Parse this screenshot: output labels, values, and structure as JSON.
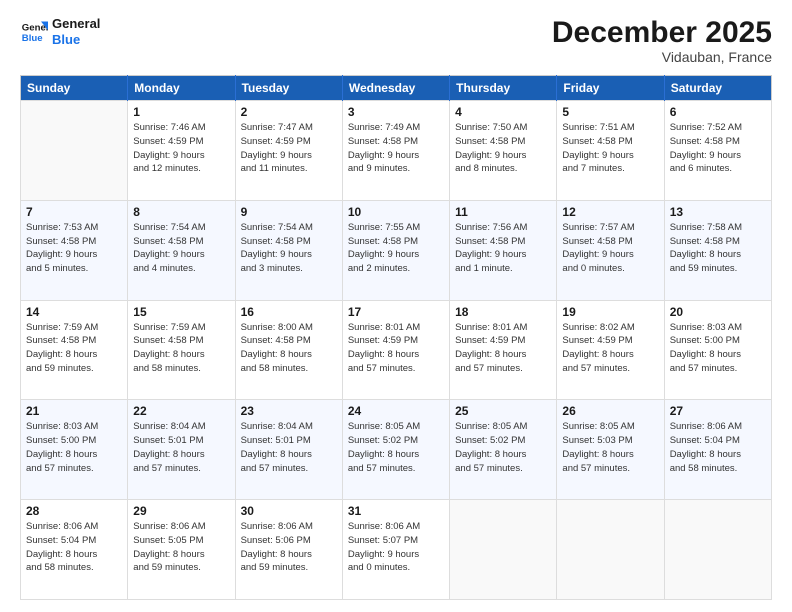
{
  "header": {
    "logo_line1": "General",
    "logo_line2": "Blue",
    "main_title": "December 2025",
    "subtitle": "Vidauban, France"
  },
  "calendar": {
    "weekdays": [
      "Sunday",
      "Monday",
      "Tuesday",
      "Wednesday",
      "Thursday",
      "Friday",
      "Saturday"
    ],
    "rows": [
      [
        {
          "day": "",
          "detail": ""
        },
        {
          "day": "1",
          "detail": "Sunrise: 7:46 AM\nSunset: 4:59 PM\nDaylight: 9 hours\nand 12 minutes."
        },
        {
          "day": "2",
          "detail": "Sunrise: 7:47 AM\nSunset: 4:59 PM\nDaylight: 9 hours\nand 11 minutes."
        },
        {
          "day": "3",
          "detail": "Sunrise: 7:49 AM\nSunset: 4:58 PM\nDaylight: 9 hours\nand 9 minutes."
        },
        {
          "day": "4",
          "detail": "Sunrise: 7:50 AM\nSunset: 4:58 PM\nDaylight: 9 hours\nand 8 minutes."
        },
        {
          "day": "5",
          "detail": "Sunrise: 7:51 AM\nSunset: 4:58 PM\nDaylight: 9 hours\nand 7 minutes."
        },
        {
          "day": "6",
          "detail": "Sunrise: 7:52 AM\nSunset: 4:58 PM\nDaylight: 9 hours\nand 6 minutes."
        }
      ],
      [
        {
          "day": "7",
          "detail": "Sunrise: 7:53 AM\nSunset: 4:58 PM\nDaylight: 9 hours\nand 5 minutes."
        },
        {
          "day": "8",
          "detail": "Sunrise: 7:54 AM\nSunset: 4:58 PM\nDaylight: 9 hours\nand 4 minutes."
        },
        {
          "day": "9",
          "detail": "Sunrise: 7:54 AM\nSunset: 4:58 PM\nDaylight: 9 hours\nand 3 minutes."
        },
        {
          "day": "10",
          "detail": "Sunrise: 7:55 AM\nSunset: 4:58 PM\nDaylight: 9 hours\nand 2 minutes."
        },
        {
          "day": "11",
          "detail": "Sunrise: 7:56 AM\nSunset: 4:58 PM\nDaylight: 9 hours\nand 1 minute."
        },
        {
          "day": "12",
          "detail": "Sunrise: 7:57 AM\nSunset: 4:58 PM\nDaylight: 9 hours\nand 0 minutes."
        },
        {
          "day": "13",
          "detail": "Sunrise: 7:58 AM\nSunset: 4:58 PM\nDaylight: 8 hours\nand 59 minutes."
        }
      ],
      [
        {
          "day": "14",
          "detail": "Sunrise: 7:59 AM\nSunset: 4:58 PM\nDaylight: 8 hours\nand 59 minutes."
        },
        {
          "day": "15",
          "detail": "Sunrise: 7:59 AM\nSunset: 4:58 PM\nDaylight: 8 hours\nand 58 minutes."
        },
        {
          "day": "16",
          "detail": "Sunrise: 8:00 AM\nSunset: 4:58 PM\nDaylight: 8 hours\nand 58 minutes."
        },
        {
          "day": "17",
          "detail": "Sunrise: 8:01 AM\nSunset: 4:59 PM\nDaylight: 8 hours\nand 57 minutes."
        },
        {
          "day": "18",
          "detail": "Sunrise: 8:01 AM\nSunset: 4:59 PM\nDaylight: 8 hours\nand 57 minutes."
        },
        {
          "day": "19",
          "detail": "Sunrise: 8:02 AM\nSunset: 4:59 PM\nDaylight: 8 hours\nand 57 minutes."
        },
        {
          "day": "20",
          "detail": "Sunrise: 8:03 AM\nSunset: 5:00 PM\nDaylight: 8 hours\nand 57 minutes."
        }
      ],
      [
        {
          "day": "21",
          "detail": "Sunrise: 8:03 AM\nSunset: 5:00 PM\nDaylight: 8 hours\nand 57 minutes."
        },
        {
          "day": "22",
          "detail": "Sunrise: 8:04 AM\nSunset: 5:01 PM\nDaylight: 8 hours\nand 57 minutes."
        },
        {
          "day": "23",
          "detail": "Sunrise: 8:04 AM\nSunset: 5:01 PM\nDaylight: 8 hours\nand 57 minutes."
        },
        {
          "day": "24",
          "detail": "Sunrise: 8:05 AM\nSunset: 5:02 PM\nDaylight: 8 hours\nand 57 minutes."
        },
        {
          "day": "25",
          "detail": "Sunrise: 8:05 AM\nSunset: 5:02 PM\nDaylight: 8 hours\nand 57 minutes."
        },
        {
          "day": "26",
          "detail": "Sunrise: 8:05 AM\nSunset: 5:03 PM\nDaylight: 8 hours\nand 57 minutes."
        },
        {
          "day": "27",
          "detail": "Sunrise: 8:06 AM\nSunset: 5:04 PM\nDaylight: 8 hours\nand 58 minutes."
        }
      ],
      [
        {
          "day": "28",
          "detail": "Sunrise: 8:06 AM\nSunset: 5:04 PM\nDaylight: 8 hours\nand 58 minutes."
        },
        {
          "day": "29",
          "detail": "Sunrise: 8:06 AM\nSunset: 5:05 PM\nDaylight: 8 hours\nand 59 minutes."
        },
        {
          "day": "30",
          "detail": "Sunrise: 8:06 AM\nSunset: 5:06 PM\nDaylight: 8 hours\nand 59 minutes."
        },
        {
          "day": "31",
          "detail": "Sunrise: 8:06 AM\nSunset: 5:07 PM\nDaylight: 9 hours\nand 0 minutes."
        },
        {
          "day": "",
          "detail": ""
        },
        {
          "day": "",
          "detail": ""
        },
        {
          "day": "",
          "detail": ""
        }
      ]
    ]
  }
}
